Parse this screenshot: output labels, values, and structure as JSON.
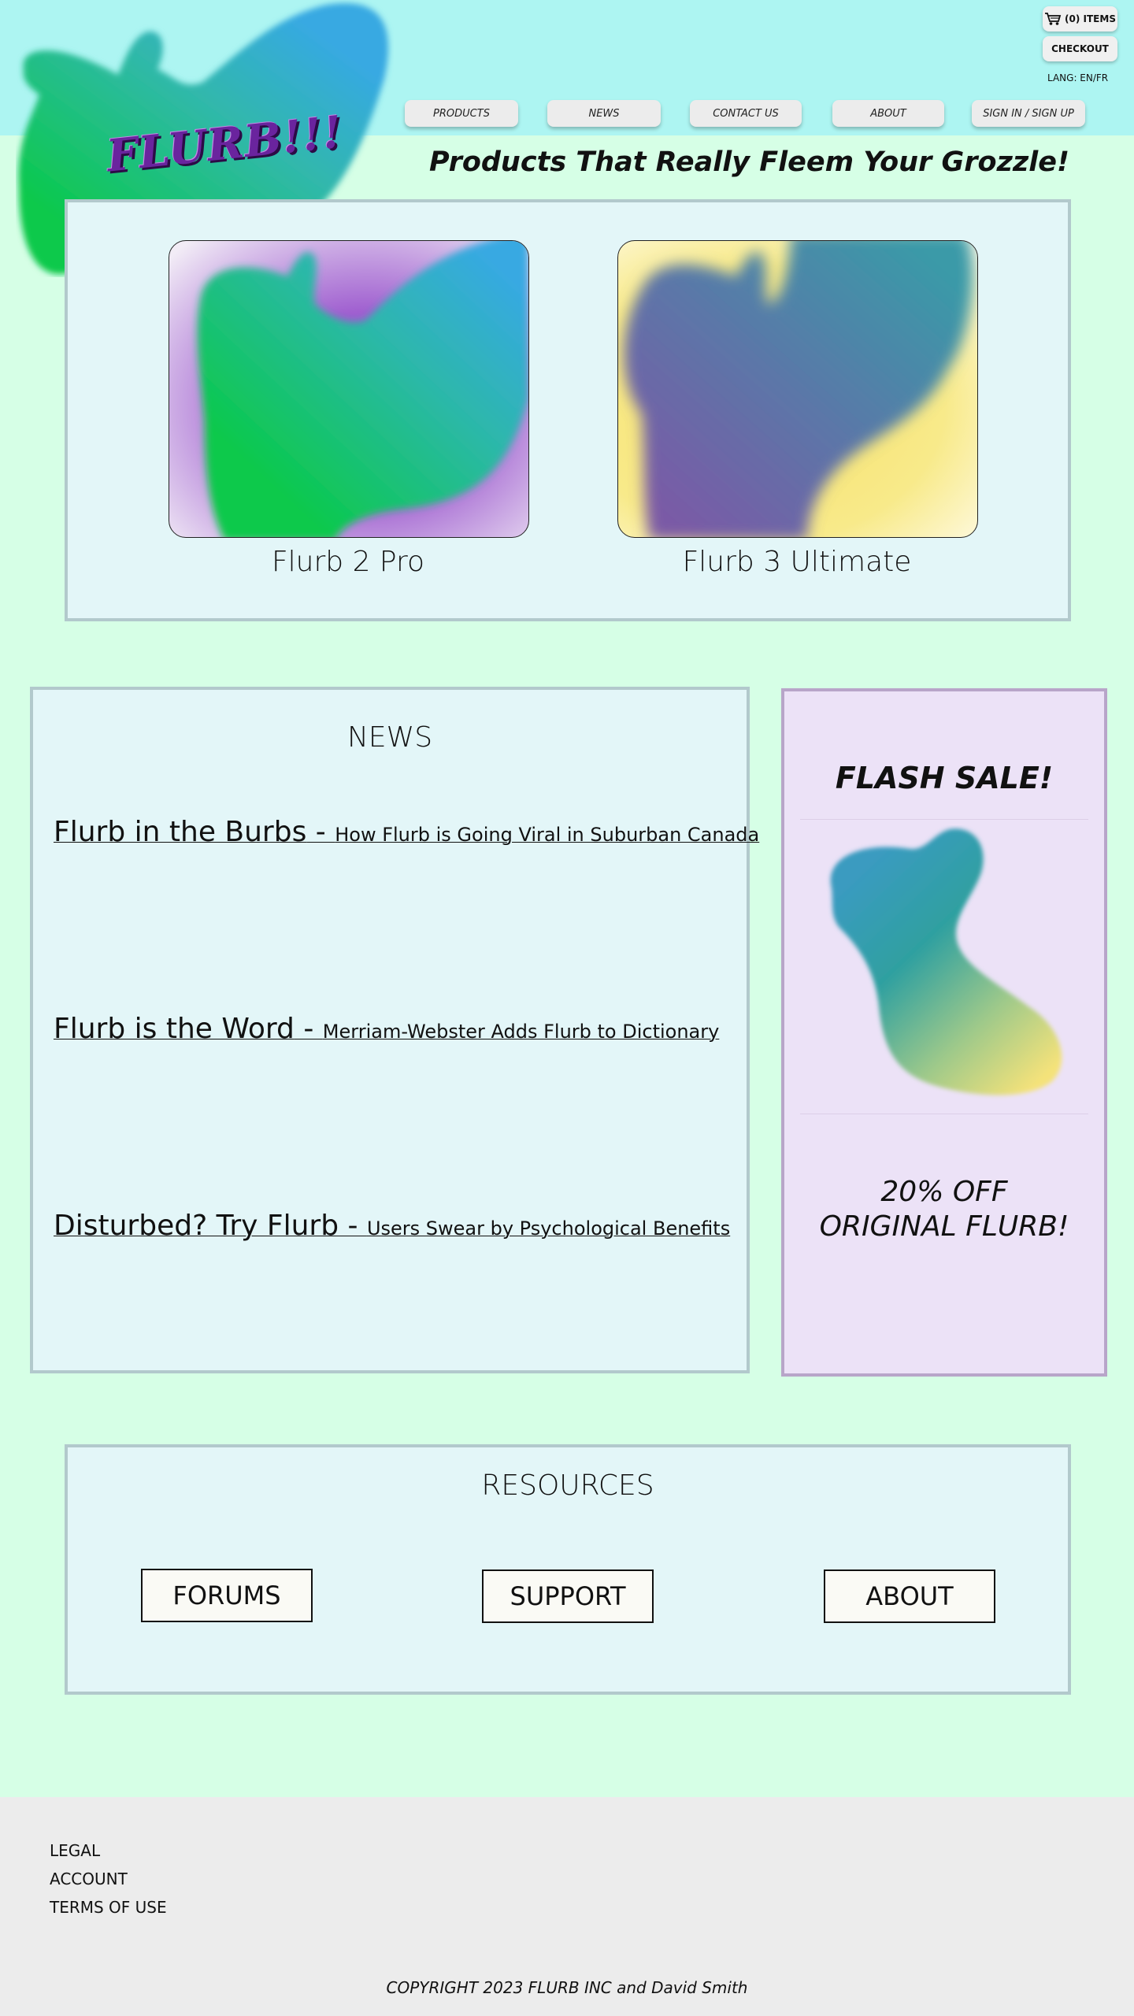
{
  "header": {
    "logo_text": "FLURB!!!",
    "nav": [
      "PRODUCTS",
      "NEWS",
      "CONTACT US",
      "ABOUT",
      "SIGN IN / SIGN UP"
    ],
    "cart_label": "(0) ITEMS",
    "checkout_label": "CHECKOUT",
    "lang_label": "LANG: EN/FR"
  },
  "tagline": "Products That Really Fleem Your Grozzle!",
  "products": [
    {
      "name": "Flurb 2 Pro"
    },
    {
      "name": "Flurb 3 Ultimate"
    }
  ],
  "news": {
    "title": "NEWS",
    "items": [
      {
        "headline": "Flurb in the Burbs",
        "sub": "How Flurb is Going Viral in Suburban Canada"
      },
      {
        "headline": "Flurb is the Word",
        "sub": "Merriam-Webster Adds Flurb to Dictionary"
      },
      {
        "headline": "Disturbed? Try Flurb",
        "sub": "Users Swear by Psychological Benefits"
      }
    ]
  },
  "sale": {
    "title": "FLASH SALE!",
    "line1": "20% OFF",
    "line2": "ORIGINAL FLURB!"
  },
  "resources": {
    "title": "RESOURCES",
    "buttons": [
      "FORUMS",
      "SUPPORT",
      "ABOUT"
    ]
  },
  "footer": {
    "links": [
      "LEGAL",
      "ACCOUNT",
      "TERMS OF USE"
    ],
    "copyright": "COPYRIGHT 2023 FLURB INC and David Smith"
  },
  "colors": {
    "page_bg": "#d6ffe6",
    "header_bg": "#adf5f2",
    "panel_bg": "#e3f6f8",
    "panel_border": "#b2c9cc",
    "sale_bg": "#ece2f7",
    "logo_text": "#6a249e",
    "footer_bg": "#ececec"
  },
  "icons": [
    "cart-icon"
  ]
}
